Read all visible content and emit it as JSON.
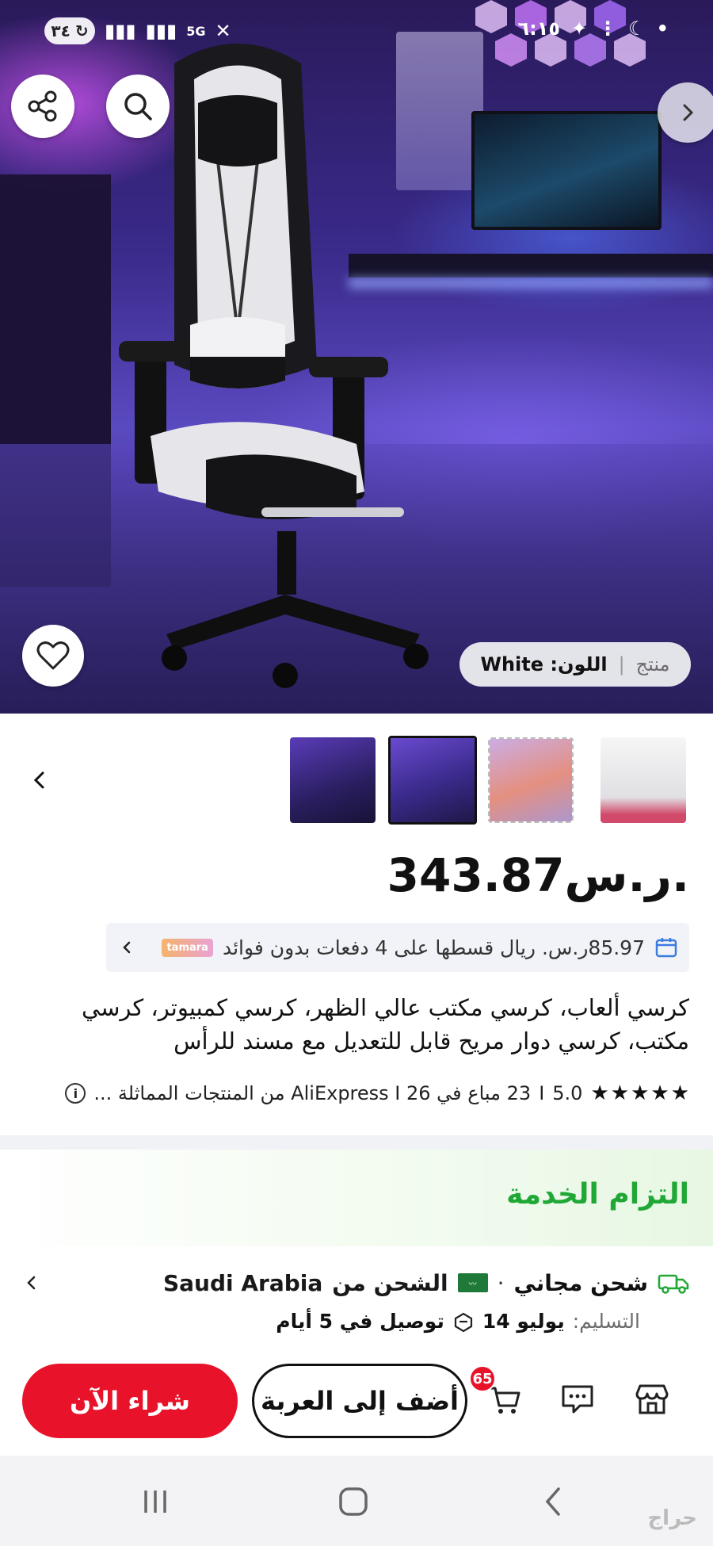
{
  "status_bar": {
    "time": "٦:١٥",
    "battery": "٣٤",
    "network": "5G"
  },
  "hero": {
    "color_pill": {
      "product_word": "منتج",
      "separator": "|",
      "color_text": "اللون: White"
    }
  },
  "price": {
    "amount": "343.87ر.س."
  },
  "installments": {
    "text": "85.97ر.س. ريال قسطها على 4 دفعات بدون فوائد",
    "brand": "tamara"
  },
  "product": {
    "title": "كرسي ألعاب، كرسي مكتب عالي الظهر، كرسي كمبيوتر، كرسي مكتب، كرسي دوار مريح قابل للتعديل مع مسند للرأس",
    "rating": "5.0",
    "rating_sep": "I",
    "sold_text": "23 مباع في AliExpress I 26 من المنتجات المماثلة ...",
    "stars_count": 5
  },
  "service": {
    "title": "التزام الخدمة",
    "free_shipping": "شحن مجاني",
    "dot": "·",
    "ship_from": "الشحن من",
    "country": "Saudi Arabia",
    "delivery_label": "التسليم:",
    "delivery_date": "يوليو 14",
    "fast_delivery": "توصيل في 5 أيام"
  },
  "actions": {
    "buy_now": "شراء الآن",
    "add_to_cart": "أضف إلى العربة",
    "cart_count": "65"
  },
  "watermark": "حراج",
  "colors": {
    "accent_red": "#e8132a",
    "service_green": "#20a836"
  },
  "icons": [
    "share-icon",
    "search-icon",
    "chevron-right-icon",
    "heart-icon",
    "chevron-left-icon",
    "calendar-icon",
    "truck-icon",
    "saudi-flag-icon",
    "shipping-badge-icon",
    "cart-icon",
    "chat-icon",
    "store-icon"
  ]
}
